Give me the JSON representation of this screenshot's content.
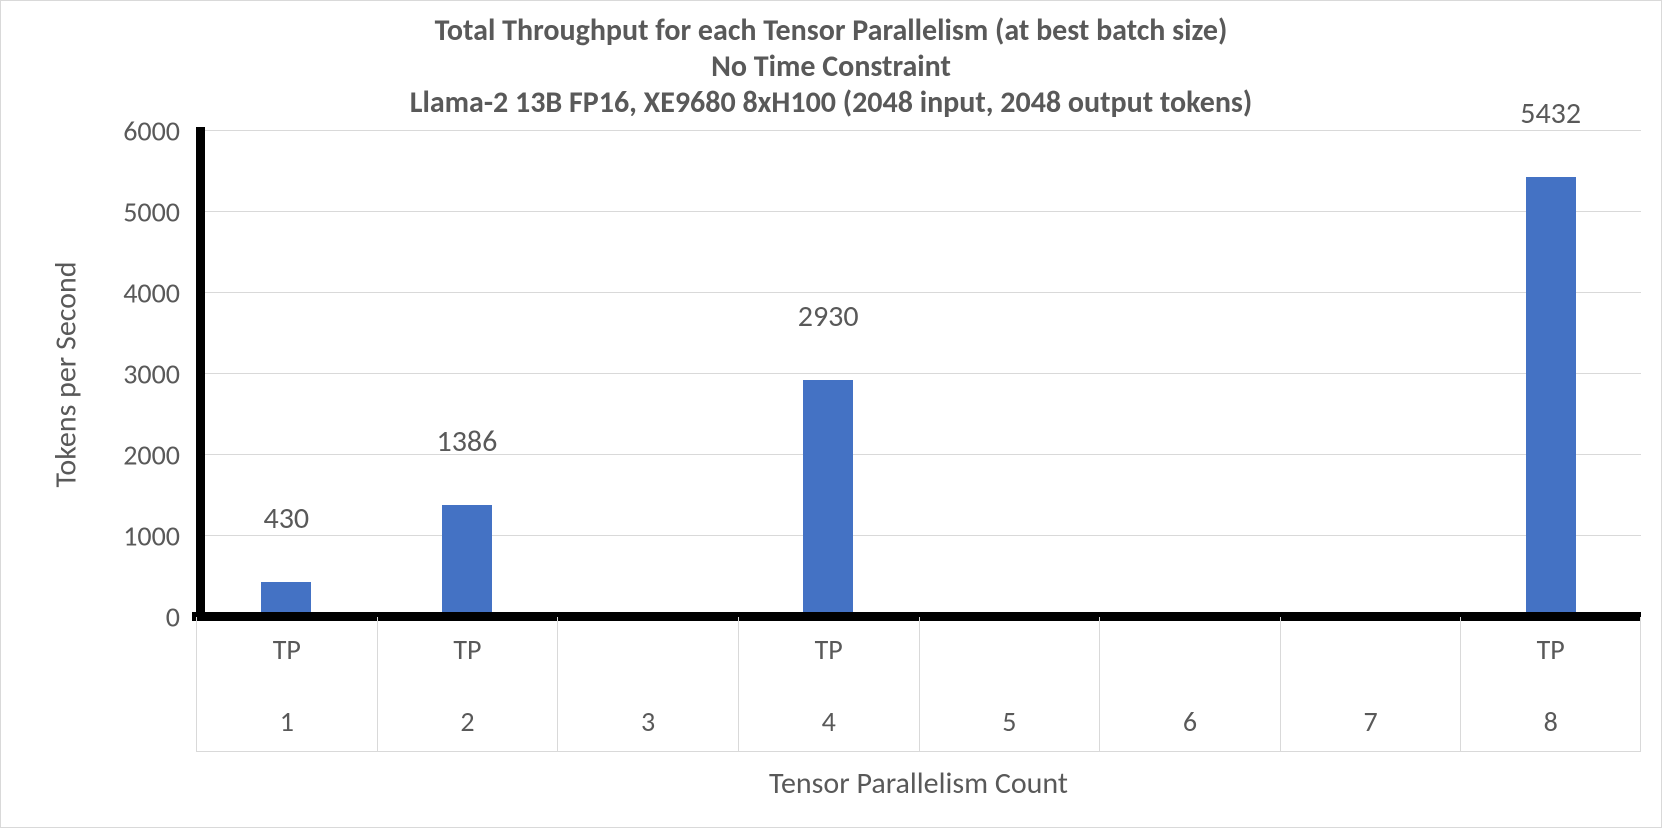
{
  "chart_data": {
    "type": "bar",
    "title_lines": [
      "Total Throughput for each Tensor Parallelism (at best batch size)",
      "No Time Constraint",
      "Llama-2 13B FP16, XE9680 8xH100 (2048 input, 2048 output tokens)"
    ],
    "xlabel": "Tensor Parallelism Count",
    "ylabel": "Tokens per Second",
    "ylim": [
      0,
      6000
    ],
    "yticks": [
      0,
      1000,
      2000,
      3000,
      4000,
      5000,
      6000
    ],
    "categories": [
      "1",
      "2",
      "3",
      "4",
      "5",
      "6",
      "7",
      "8"
    ],
    "category_prefix": "TP",
    "values": [
      430,
      1386,
      null,
      2930,
      null,
      null,
      null,
      5432
    ],
    "bar_color": "#4472c4"
  }
}
